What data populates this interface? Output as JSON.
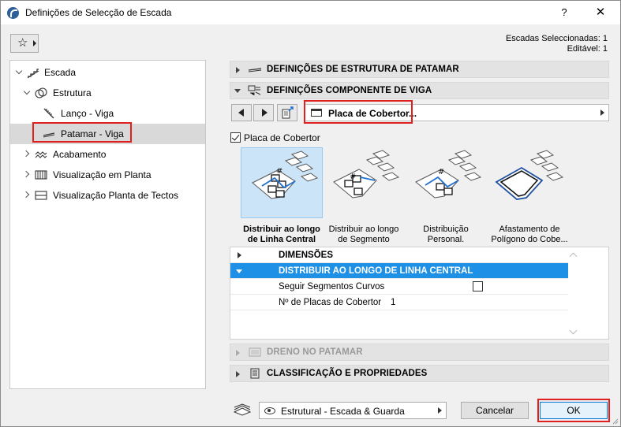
{
  "window": {
    "title": "Definições de Selecção de Escada",
    "help_label": "?",
    "close_label": "✕"
  },
  "selection_info": {
    "line1": "Escadas Seleccionadas: 1",
    "line2": "Editável: 1"
  },
  "tree": {
    "items": [
      {
        "label": "Escada",
        "icon": "stair-icon",
        "expanded": true
      },
      {
        "label": "Estrutura",
        "icon": "structure-icon",
        "expanded": true
      },
      {
        "label": "Lanço - Viga",
        "icon": "flight-beam-icon"
      },
      {
        "label": "Patamar - Viga",
        "icon": "landing-beam-icon",
        "selected": true
      },
      {
        "label": "Acabamento",
        "icon": "finish-icon",
        "expanded": false
      },
      {
        "label": "Visualização em Planta",
        "icon": "floor-plan-icon",
        "expanded": false
      },
      {
        "label": "Visualização Planta de Tectos",
        "icon": "ceiling-plan-icon",
        "expanded": false
      }
    ]
  },
  "panels": {
    "landing_structure": "DEFINIÇÕES DE ESTRUTURA DE PATAMAR",
    "beam_component": "DEFINIÇÕES COMPONENTE DE VIGA",
    "drain": "DRENO NO PATAMAR",
    "classification": "CLASSIFICAÇÃO E PROPRIEDADES"
  },
  "component_selector": {
    "value": "Placa de Cobertor..."
  },
  "cover_plate": {
    "checkbox_label": "Placa de Cobertor",
    "checked": true
  },
  "options": [
    {
      "line1": "Distribuir ao longo",
      "line2": "de Linha Central",
      "selected": true
    },
    {
      "line1": "Distribuir ao longo",
      "line2": "de Segmento",
      "selected": false
    },
    {
      "line1": "Distribuição",
      "line2": "Personal.",
      "selected": false
    },
    {
      "line1": "Afastamento de",
      "line2": "Polígono do Cobe...",
      "selected": false
    }
  ],
  "properties": {
    "dimensions": "DIMENSÕES",
    "distribute_group": "DISTRIBUIR AO LONGO DE LINHA CENTRAL",
    "follow_curved_label": "Seguir Segmentos Curvos",
    "follow_curved_checked": false,
    "plate_count_label": "Nº de Placas de Cobertor",
    "plate_count_value": "1"
  },
  "footer": {
    "view_combo": "Estrutural - Escada & Guarda",
    "cancel_label": "Cancelar",
    "ok_label": "OK"
  },
  "colors": {
    "selection_blue": "#1e90e6",
    "highlight_red": "#e02020",
    "tile_selected": "#cce4f7"
  }
}
